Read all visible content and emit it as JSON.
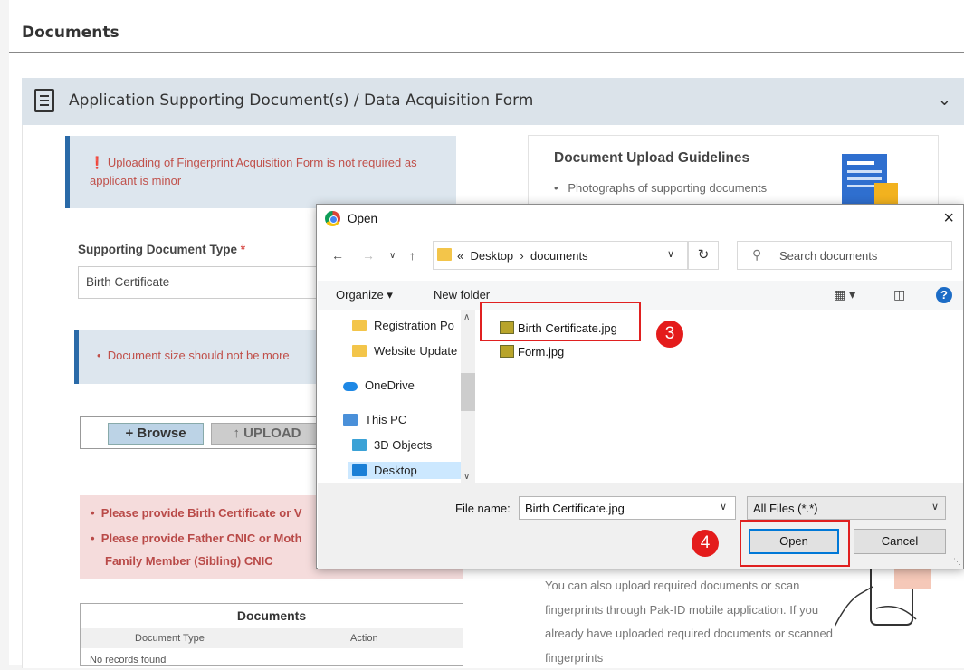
{
  "page": {
    "title": "Documents"
  },
  "section": {
    "title": "Application Supporting Document(s) / Data Acquisition Form",
    "chevron": "chevron-down-icon"
  },
  "form": {
    "info_note": "Uploading of Fingerprint Acquisition Form is not required as applicant is minor",
    "doc_type_label": "Supporting Document Type",
    "required_mark": "*",
    "doc_type_value": "Birth Certificate",
    "size_note": "Document size should not be more",
    "browse_label": "+ Browse",
    "upload_label": "UPLOAD",
    "errors": [
      "Please provide Birth Certificate or V",
      "Please provide Father CNIC or Moth",
      "Family Member (Sibling) CNIC"
    ]
  },
  "docs_table": {
    "title": "Documents",
    "columns": [
      "Document Type",
      "Action"
    ],
    "empty": "No records found"
  },
  "guidelines": {
    "title": "Document Upload Guidelines",
    "item1": "Photographs of supporting documents",
    "mobile_text": "You can also upload required documents or scan fingerprints through Pak-ID mobile application. If you already have uploaded required documents or scanned fingerprints"
  },
  "dialog": {
    "title": "Open",
    "close": "×",
    "address": [
      "«",
      "Desktop",
      "›",
      "documents"
    ],
    "search_placeholder": "Search documents",
    "organize": "Organize ▾",
    "new_folder": "New folder",
    "nav_items": [
      "Registration Po",
      "Website Update",
      "OneDrive",
      "This PC",
      "3D Objects",
      "Desktop"
    ],
    "files": [
      "Birth Certificate.jpg",
      "Form.jpg"
    ],
    "file_name_label": "File name:",
    "file_name_value": "Birth Certificate.jpg",
    "file_type": "All Files (*.*)",
    "open_label": "Open",
    "cancel_label": "Cancel"
  },
  "markers": {
    "step3": "3",
    "step4": "4"
  },
  "colors": {
    "highlight": "#e02020",
    "marker": "#e41c1c",
    "accent_blue": "#0078d7",
    "info_border": "#2a6aa8",
    "error_text": "#b94a48"
  }
}
